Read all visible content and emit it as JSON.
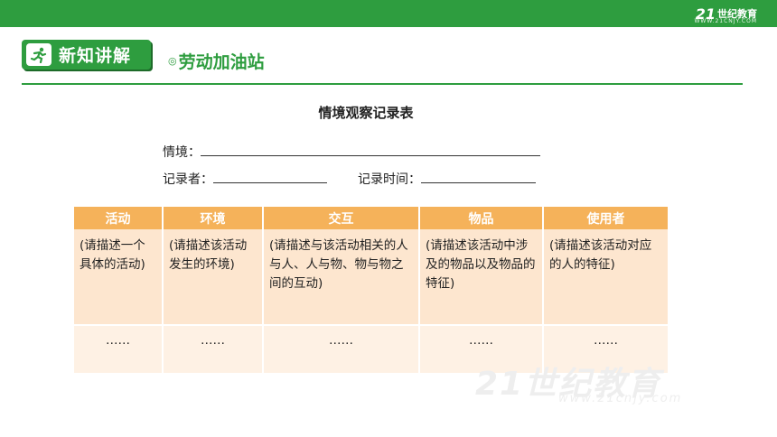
{
  "header": {
    "brand_mark": "21",
    "brand_name": "世纪教育",
    "brand_url": "WWW.21CNJY.COM"
  },
  "section": {
    "icon": "running-person-icon",
    "label": "新知讲解",
    "subtitle_bullet": "◎",
    "subtitle": "劳动加油站"
  },
  "form": {
    "title": "情境观察记录表",
    "situation_label": "情境：",
    "recorder_label": "记录者：",
    "time_label": "记录时间："
  },
  "table": {
    "headers": [
      "活动",
      "环境",
      "交互",
      "物品",
      "使用者"
    ],
    "rows": [
      [
        "(请描述一个具体的活动)",
        "(请描述该活动发生的环境)",
        "(请描述与该活动相关的人与人、人与物、物与物之间的互动)",
        "(请描述该活动中涉及的物品以及物品的特征)",
        "(请描述该活动对应的人的特征)"
      ],
      [
        "……",
        "……",
        "……",
        "……",
        "……"
      ]
    ]
  },
  "watermark": {
    "text": "21世纪教育",
    "url": "www.21cnjy.com"
  },
  "colors": {
    "green": "#2e9d3f",
    "header_orange": "#f5b25a",
    "cell_peach": "#fde6cf"
  }
}
